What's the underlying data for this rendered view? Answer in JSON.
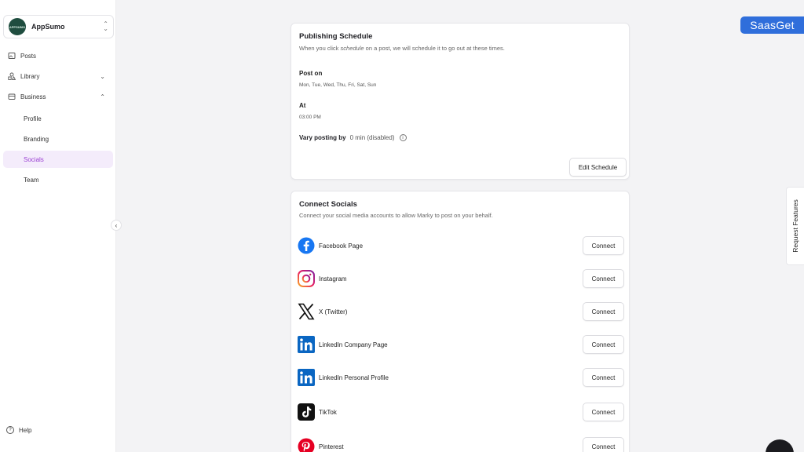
{
  "sidebar": {
    "workspace": {
      "name": "AppSumo",
      "logo_text": "APPSUMO"
    },
    "nav": [
      {
        "label": "Posts"
      },
      {
        "label": "Library"
      },
      {
        "label": "Business"
      }
    ],
    "business_sub": [
      {
        "label": "Profile"
      },
      {
        "label": "Branding"
      },
      {
        "label": "Socials"
      },
      {
        "label": "Team"
      }
    ],
    "active_item": "Socials",
    "help_label": "Help"
  },
  "schedule": {
    "title": "Publishing Schedule",
    "subtitle_pre": "When you click",
    "subtitle_em": "schedule",
    "subtitle_post": "on a post, we will schedule it to go out at these times.",
    "post_on_label": "Post on",
    "post_on_value": "Mon, Tue, Wed, Thu, Fri, Sat, Sun",
    "at_label": "At",
    "at_value": "03:00 PM",
    "vary_label": "Vary posting by",
    "vary_value": "0 min (disabled)",
    "edit_button": "Edit Schedule"
  },
  "connect": {
    "title": "Connect Socials",
    "subtitle": "Connect your social media accounts to allow Marky to post on your behalf.",
    "button_label": "Connect",
    "items": [
      {
        "name": "Facebook Page",
        "icon": "facebook-icon"
      },
      {
        "name": "Instagram",
        "icon": "instagram-icon"
      },
      {
        "name": "X (Twitter)",
        "icon": "x-twitter-icon"
      },
      {
        "name": "LinkedIn Company Page",
        "icon": "linkedin-icon"
      },
      {
        "name": "LinkedIn Personal Profile",
        "icon": "linkedin-icon"
      },
      {
        "name": "TikTok",
        "icon": "tiktok-icon"
      },
      {
        "name": "Pinterest",
        "icon": "pinterest-icon"
      }
    ]
  },
  "overlay": {
    "brand_badge": "SaasGet",
    "request_features": "Request Features"
  },
  "colors": {
    "accent": "#9a3fd3",
    "active_bg": "#f4ecfb",
    "facebook": "#1877f2",
    "linkedin": "#0a66c2",
    "pinterest": "#e60023",
    "badge": "#2f6edb"
  }
}
